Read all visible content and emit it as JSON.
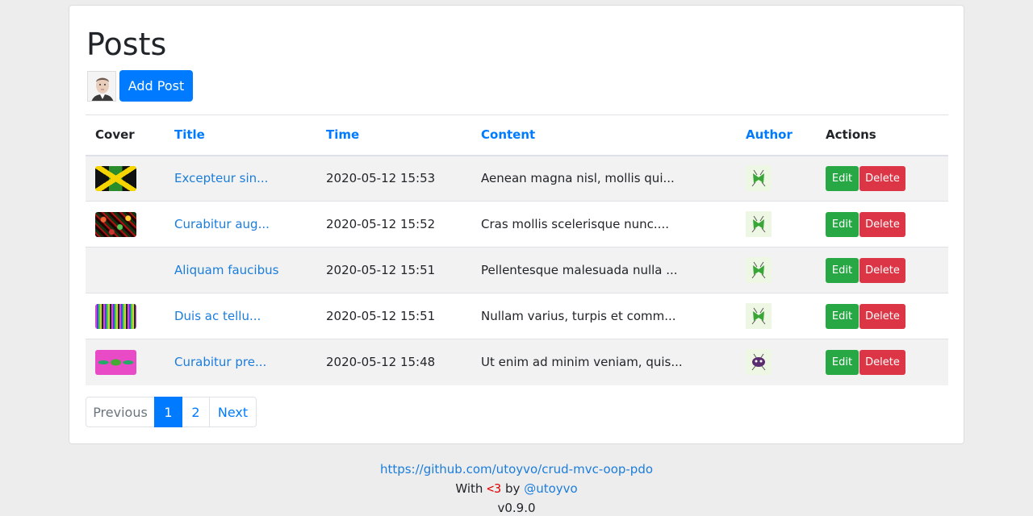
{
  "page": {
    "title": "Posts",
    "add_post_label": "Add Post"
  },
  "table": {
    "headers": {
      "cover": "Cover",
      "title": "Title",
      "time": "Time",
      "content": "Content",
      "author": "Author",
      "actions": "Actions"
    },
    "rows": [
      {
        "title": "Excepteur sin...",
        "time": "2020-05-12 15:53",
        "content": "Aenean magna nisl, mollis qui...",
        "has_cover": true
      },
      {
        "title": "Curabitur aug...",
        "time": "2020-05-12 15:52",
        "content": "Cras mollis scelerisque nunc....",
        "has_cover": true
      },
      {
        "title": "Aliquam faucibus",
        "time": "2020-05-12 15:51",
        "content": "Pellentesque malesuada nulla ...",
        "has_cover": false
      },
      {
        "title": "Duis ac tellu...",
        "time": "2020-05-12 15:51",
        "content": "Nullam varius, turpis et comm...",
        "has_cover": true
      },
      {
        "title": "Curabitur pre...",
        "time": "2020-05-12 15:48",
        "content": "Ut enim ad minim veniam, quis...",
        "has_cover": true
      }
    ],
    "edit_label": "Edit",
    "delete_label": "Delete"
  },
  "pagination": {
    "previous": "Previous",
    "pages": [
      "1",
      "2"
    ],
    "active_page": "1",
    "next": "Next"
  },
  "footer": {
    "repo_link": "https://github.com/utoyvo/crud-mvc-oop-pdo",
    "with": "With",
    "heart": "<3",
    "by": "by",
    "author_handle": "@utoyvo",
    "version": "v0.9.0"
  },
  "colors": {
    "primary": "#007bff",
    "success": "#28a745",
    "danger": "#dc3545"
  }
}
